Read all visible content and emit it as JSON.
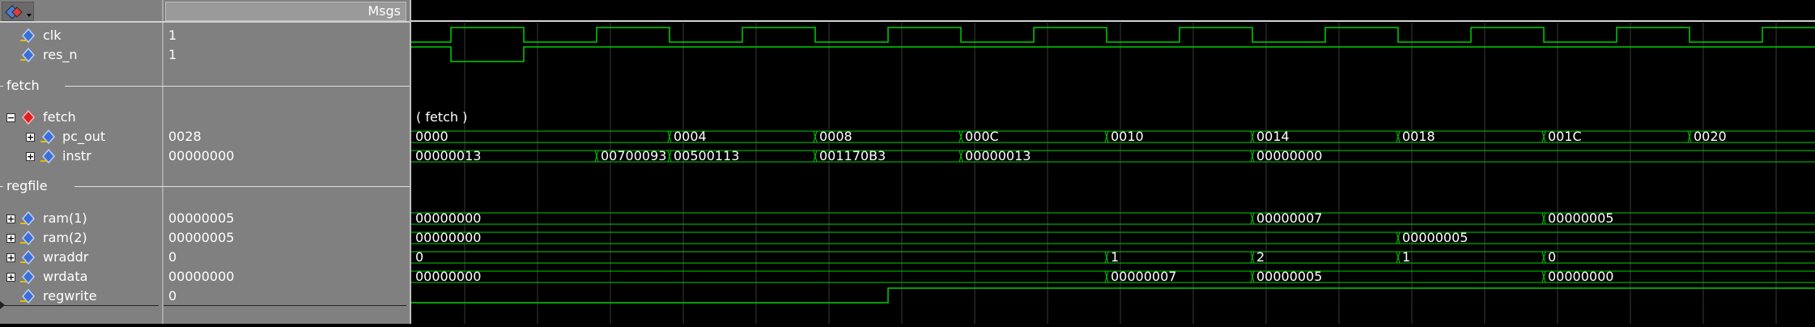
{
  "header": {
    "msgs_label": "Msgs"
  },
  "colors": {
    "wave": "#00d000",
    "grid": "#3a3a3a",
    "bus_text": "#ffffff",
    "pane_bg": "#808080"
  },
  "cursor_ticks": [
    0,
    1,
    2,
    3,
    4,
    5,
    6,
    7,
    8,
    9,
    10,
    11,
    12,
    13,
    14,
    15,
    16,
    17,
    18
  ],
  "signals": [
    {
      "id": "clk",
      "name": "clk",
      "value": "1",
      "expandable": false,
      "icon": "diamond-blue-icon"
    },
    {
      "id": "res_n",
      "name": "res_n",
      "value": "1",
      "expandable": false,
      "icon": "diamond-blue-icon"
    },
    {
      "id": "div_fetch",
      "divider": "fetch"
    },
    {
      "id": "fetch",
      "name": "fetch",
      "value": "",
      "expandable": true,
      "expanded": true,
      "icon": "diamond-red-icon",
      "wave_label": "( fetch )"
    },
    {
      "id": "pc_out",
      "name": "pc_out",
      "value": "0028",
      "expandable": true,
      "icon": "diamond-blue-icon",
      "bus": [
        "0000",
        "0004",
        "0008",
        "000C",
        "0010",
        "0014",
        "0018",
        "001C",
        "0020"
      ]
    },
    {
      "id": "instr",
      "name": "instr",
      "value": "00000000",
      "expandable": true,
      "icon": "diamond-blue-icon",
      "bus": [
        "00000013",
        "00700093",
        "00500113",
        "001170B3",
        "00000013",
        "00000000"
      ]
    },
    {
      "id": "div_regfile",
      "divider": "regfile"
    },
    {
      "id": "ram1",
      "name": "ram(1)",
      "value": "00000005",
      "expandable": true,
      "icon": "diamond-blue-icon",
      "bus": [
        "00000000",
        "00000007",
        "00000005"
      ]
    },
    {
      "id": "ram2",
      "name": "ram(2)",
      "value": "00000005",
      "expandable": true,
      "icon": "diamond-blue-icon",
      "bus": [
        "00000000",
        "00000005"
      ]
    },
    {
      "id": "wraddr",
      "name": "wraddr",
      "value": "0",
      "expandable": true,
      "icon": "diamond-blue-icon",
      "bus": [
        "0",
        "1",
        "2",
        "1",
        "0"
      ]
    },
    {
      "id": "wrdata",
      "name": "wrdata",
      "value": "00000000",
      "expandable": true,
      "icon": "diamond-blue-icon",
      "bus": [
        "00000000",
        "00000007",
        "00000005",
        "00000000"
      ]
    },
    {
      "id": "regwrite",
      "name": "regwrite",
      "value": "0",
      "expandable": false,
      "icon": "diamond-blue-icon"
    }
  ]
}
